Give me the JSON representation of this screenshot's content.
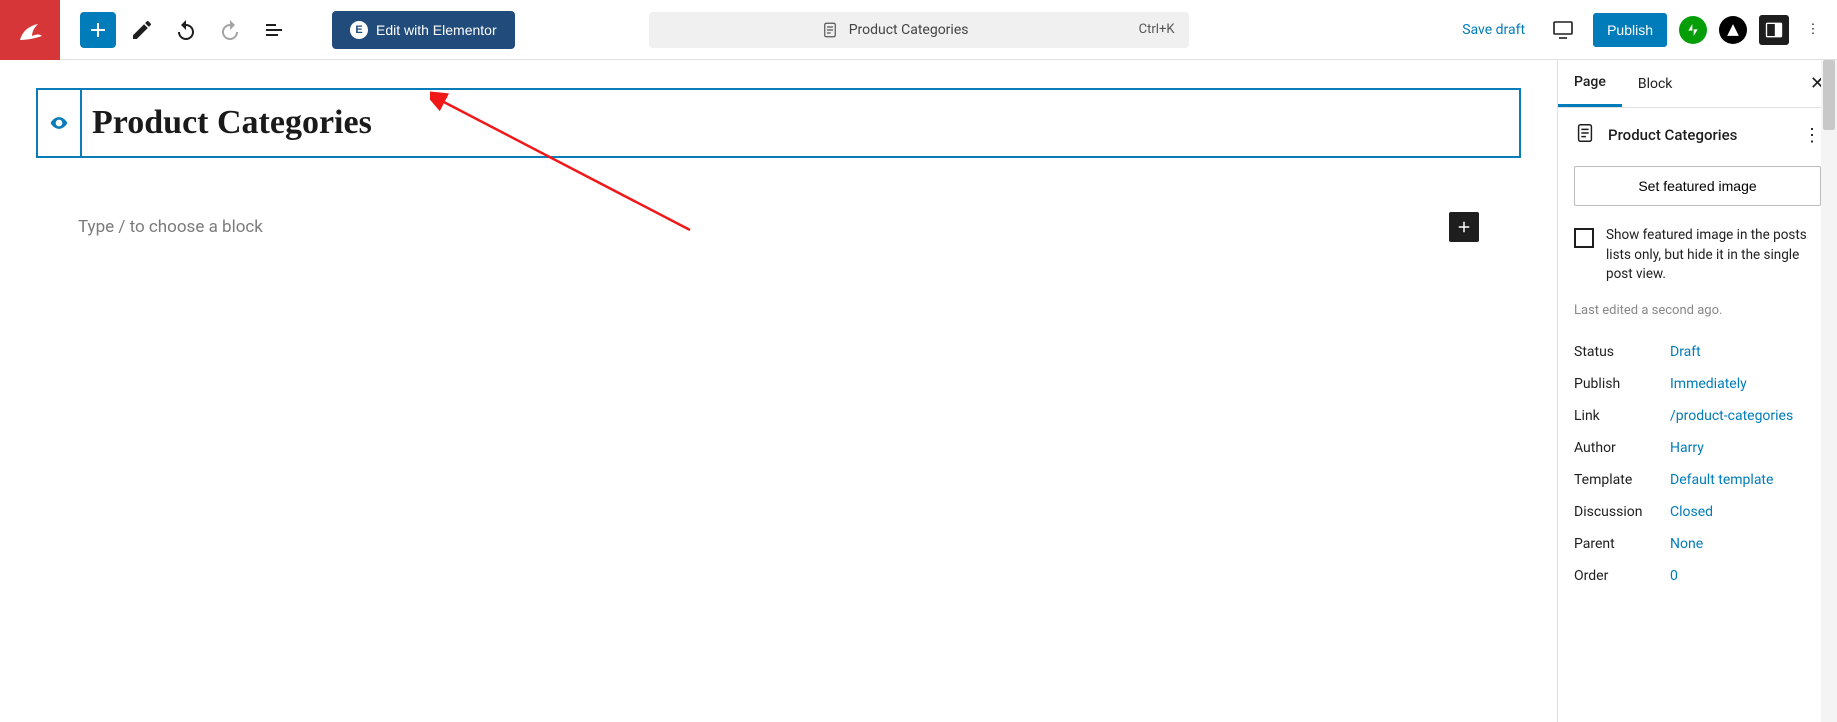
{
  "toolbar": {
    "elementor_label": "Edit with Elementor",
    "center_title": "Product Categories",
    "center_shortcut": "Ctrl+K",
    "save_draft_label": "Save draft",
    "publish_label": "Publish"
  },
  "editor": {
    "title_value": "Product Categories",
    "block_placeholder": "Type / to choose a block"
  },
  "sidebar": {
    "tabs": {
      "page": "Page",
      "block": "Block"
    },
    "panel_title": "Product Categories",
    "featured_image_label": "Set featured image",
    "featured_checkbox_text": "Show featured image in the posts lists only, but hide it in the single post view.",
    "last_edited": "Last edited a second ago.",
    "meta": {
      "status_label": "Status",
      "status_value": "Draft",
      "publish_label": "Publish",
      "publish_value": "Immediately",
      "link_label": "Link",
      "link_value": "/product-categories",
      "author_label": "Author",
      "author_value": "Harry",
      "template_label": "Template",
      "template_value": "Default template",
      "discussion_label": "Discussion",
      "discussion_value": "Closed",
      "parent_label": "Parent",
      "parent_value": "None",
      "order_label": "Order",
      "order_value": "0"
    }
  }
}
